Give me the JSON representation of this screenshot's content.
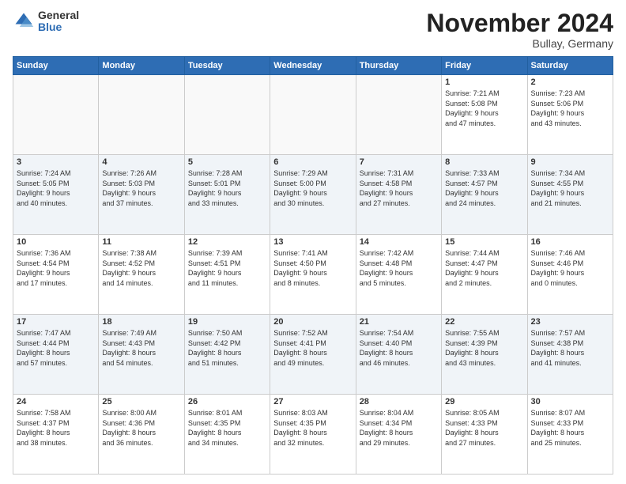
{
  "logo": {
    "general": "General",
    "blue": "Blue"
  },
  "header": {
    "month": "November 2024",
    "location": "Bullay, Germany"
  },
  "weekdays": [
    "Sunday",
    "Monday",
    "Tuesday",
    "Wednesday",
    "Thursday",
    "Friday",
    "Saturday"
  ],
  "weeks": [
    [
      {
        "day": "",
        "info": ""
      },
      {
        "day": "",
        "info": ""
      },
      {
        "day": "",
        "info": ""
      },
      {
        "day": "",
        "info": ""
      },
      {
        "day": "",
        "info": ""
      },
      {
        "day": "1",
        "info": "Sunrise: 7:21 AM\nSunset: 5:08 PM\nDaylight: 9 hours\nand 47 minutes."
      },
      {
        "day": "2",
        "info": "Sunrise: 7:23 AM\nSunset: 5:06 PM\nDaylight: 9 hours\nand 43 minutes."
      }
    ],
    [
      {
        "day": "3",
        "info": "Sunrise: 7:24 AM\nSunset: 5:05 PM\nDaylight: 9 hours\nand 40 minutes."
      },
      {
        "day": "4",
        "info": "Sunrise: 7:26 AM\nSunset: 5:03 PM\nDaylight: 9 hours\nand 37 minutes."
      },
      {
        "day": "5",
        "info": "Sunrise: 7:28 AM\nSunset: 5:01 PM\nDaylight: 9 hours\nand 33 minutes."
      },
      {
        "day": "6",
        "info": "Sunrise: 7:29 AM\nSunset: 5:00 PM\nDaylight: 9 hours\nand 30 minutes."
      },
      {
        "day": "7",
        "info": "Sunrise: 7:31 AM\nSunset: 4:58 PM\nDaylight: 9 hours\nand 27 minutes."
      },
      {
        "day": "8",
        "info": "Sunrise: 7:33 AM\nSunset: 4:57 PM\nDaylight: 9 hours\nand 24 minutes."
      },
      {
        "day": "9",
        "info": "Sunrise: 7:34 AM\nSunset: 4:55 PM\nDaylight: 9 hours\nand 21 minutes."
      }
    ],
    [
      {
        "day": "10",
        "info": "Sunrise: 7:36 AM\nSunset: 4:54 PM\nDaylight: 9 hours\nand 17 minutes."
      },
      {
        "day": "11",
        "info": "Sunrise: 7:38 AM\nSunset: 4:52 PM\nDaylight: 9 hours\nand 14 minutes."
      },
      {
        "day": "12",
        "info": "Sunrise: 7:39 AM\nSunset: 4:51 PM\nDaylight: 9 hours\nand 11 minutes."
      },
      {
        "day": "13",
        "info": "Sunrise: 7:41 AM\nSunset: 4:50 PM\nDaylight: 9 hours\nand 8 minutes."
      },
      {
        "day": "14",
        "info": "Sunrise: 7:42 AM\nSunset: 4:48 PM\nDaylight: 9 hours\nand 5 minutes."
      },
      {
        "day": "15",
        "info": "Sunrise: 7:44 AM\nSunset: 4:47 PM\nDaylight: 9 hours\nand 2 minutes."
      },
      {
        "day": "16",
        "info": "Sunrise: 7:46 AM\nSunset: 4:46 PM\nDaylight: 9 hours\nand 0 minutes."
      }
    ],
    [
      {
        "day": "17",
        "info": "Sunrise: 7:47 AM\nSunset: 4:44 PM\nDaylight: 8 hours\nand 57 minutes."
      },
      {
        "day": "18",
        "info": "Sunrise: 7:49 AM\nSunset: 4:43 PM\nDaylight: 8 hours\nand 54 minutes."
      },
      {
        "day": "19",
        "info": "Sunrise: 7:50 AM\nSunset: 4:42 PM\nDaylight: 8 hours\nand 51 minutes."
      },
      {
        "day": "20",
        "info": "Sunrise: 7:52 AM\nSunset: 4:41 PM\nDaylight: 8 hours\nand 49 minutes."
      },
      {
        "day": "21",
        "info": "Sunrise: 7:54 AM\nSunset: 4:40 PM\nDaylight: 8 hours\nand 46 minutes."
      },
      {
        "day": "22",
        "info": "Sunrise: 7:55 AM\nSunset: 4:39 PM\nDaylight: 8 hours\nand 43 minutes."
      },
      {
        "day": "23",
        "info": "Sunrise: 7:57 AM\nSunset: 4:38 PM\nDaylight: 8 hours\nand 41 minutes."
      }
    ],
    [
      {
        "day": "24",
        "info": "Sunrise: 7:58 AM\nSunset: 4:37 PM\nDaylight: 8 hours\nand 38 minutes."
      },
      {
        "day": "25",
        "info": "Sunrise: 8:00 AM\nSunset: 4:36 PM\nDaylight: 8 hours\nand 36 minutes."
      },
      {
        "day": "26",
        "info": "Sunrise: 8:01 AM\nSunset: 4:35 PM\nDaylight: 8 hours\nand 34 minutes."
      },
      {
        "day": "27",
        "info": "Sunrise: 8:03 AM\nSunset: 4:35 PM\nDaylight: 8 hours\nand 32 minutes."
      },
      {
        "day": "28",
        "info": "Sunrise: 8:04 AM\nSunset: 4:34 PM\nDaylight: 8 hours\nand 29 minutes."
      },
      {
        "day": "29",
        "info": "Sunrise: 8:05 AM\nSunset: 4:33 PM\nDaylight: 8 hours\nand 27 minutes."
      },
      {
        "day": "30",
        "info": "Sunrise: 8:07 AM\nSunset: 4:33 PM\nDaylight: 8 hours\nand 25 minutes."
      }
    ]
  ]
}
